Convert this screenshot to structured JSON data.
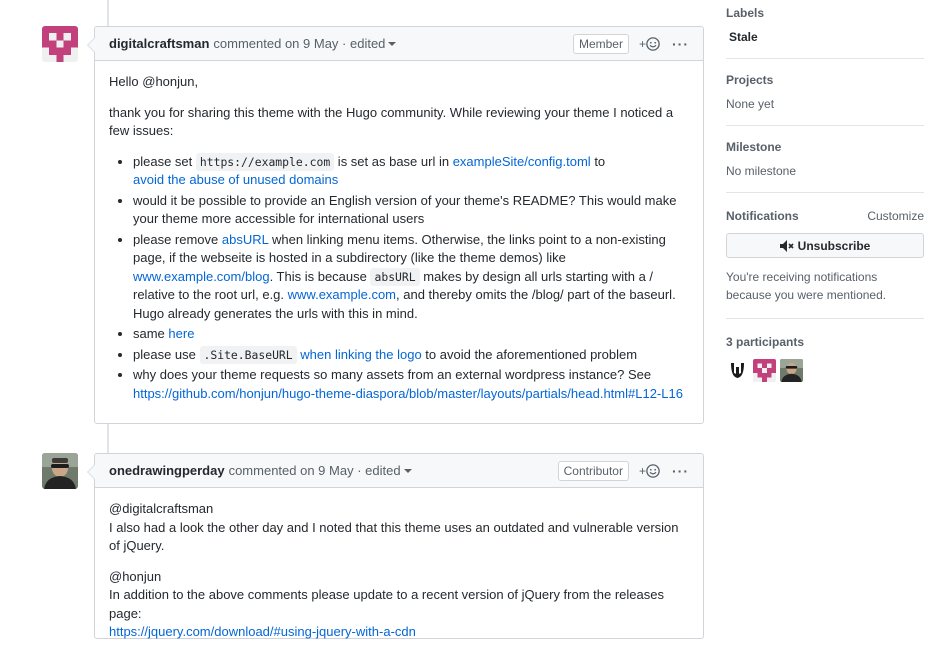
{
  "comments": [
    {
      "author": "digitalcraftsman",
      "meta": "commented on 9 May · edited",
      "badge": "Member",
      "react": "+",
      "greeting_prefix": "Hello ",
      "greeting_mention": "@honjun",
      "greeting_suffix": ",",
      "intro": "thank you for sharing this theme with the Hugo community. While reviewing your theme I noticed a few issues:",
      "items": {
        "i1": {
          "t1": "please set ",
          "code1": "https://example.com",
          "t2": " is set as base url in ",
          "link1": "exampleSite/config.toml",
          "t3": " to",
          "link2": "avoid the abuse of unused domains"
        },
        "i2": {
          "text": "would it be possible to provide an English version of your theme's README? This would make your theme more accessible for international users"
        },
        "i3": {
          "t1": "please remove ",
          "link1": "absURL",
          "t2": " when linking menu items. Otherwise, the links point to a non-existing page, if the webseite is hosted in a subdirectory (like the theme demos) like ",
          "link2": "www.example.com/blog",
          "t3": ". This is because ",
          "code1": "absURL",
          "t4": " makes by design all urls starting with a / relative to the root url, e.g. ",
          "link3": "www.example.com",
          "t5": ", and thereby omits the /blog/ part of the baseurl. Hugo already generates the urls with this in mind."
        },
        "i4": {
          "t1": "same ",
          "link1": "here"
        },
        "i5": {
          "t1": "please use ",
          "code1": ".Site.BaseURL",
          "link1": " when linking the logo",
          "t2": " to avoid the aforementioned problem"
        },
        "i6": {
          "t1": "why does your theme requests so many assets from an external wordpress instance? See",
          "link1": "https://github.com/honjun/hugo-theme-diaspora/blob/master/layouts/partials/head.html#L12-L16"
        }
      }
    },
    {
      "author": "onedrawingperday",
      "meta": "commented on 9 May · edited",
      "badge": "Contributor",
      "react": "+",
      "mention1": "@digitalcraftsman",
      "p1": "I also had a look the other day and I noted that this theme uses an outdated and vulnerable version of jQuery.",
      "mention2": "@honjun",
      "p2": "In addition to the above comments please update to a recent version of jQuery from the releases page:",
      "link1": "https://jquery.com/download/#using-jquery-with-a-cdn"
    }
  ],
  "sidebar": {
    "labels": {
      "title": "Labels",
      "value": "Stale"
    },
    "projects": {
      "title": "Projects",
      "value": "None yet"
    },
    "milestone": {
      "title": "Milestone",
      "value": "No milestone"
    },
    "notifications": {
      "title": "Notifications",
      "customize": "Customize",
      "button": "Unsubscribe",
      "note": "You're receiving notifications because you were mentioned."
    },
    "participants": {
      "title": "3 participants"
    }
  },
  "colors": {
    "link": "#0366d6",
    "avatar_pink": "#c2417c",
    "border": "#d1d5da"
  }
}
